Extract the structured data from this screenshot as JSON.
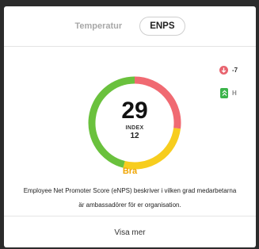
{
  "tabs": [
    {
      "label": "Temperatur",
      "active": false
    },
    {
      "label": "ENPS",
      "active": true
    }
  ],
  "gauge": {
    "score": "29",
    "index_label": "INDEX",
    "index_value": "12",
    "segments": [
      {
        "name": "detractors",
        "fraction": 0.46,
        "color": "#6ac13d"
      },
      {
        "name": "passives",
        "fraction": 0.27,
        "color": "#f7cd1e"
      },
      {
        "name": "promoters",
        "fraction": 0.27,
        "color": "#f06a72"
      }
    ]
  },
  "trend": {
    "value": "-7",
    "icon": "arrow-down-icon",
    "color": "#e8646f"
  },
  "level": {
    "value": "H",
    "icon": "double-chevron-up-icon",
    "color": "#3bb44a"
  },
  "rating": {
    "label": "Bra",
    "color": "#f0a500"
  },
  "description": {
    "line1": "Employee Net Promoter Score (eNPS) beskriver i vilken grad medarbetarna",
    "line2": "är ambassadörer för er organisation."
  },
  "show_more_label": "Visa mer"
}
